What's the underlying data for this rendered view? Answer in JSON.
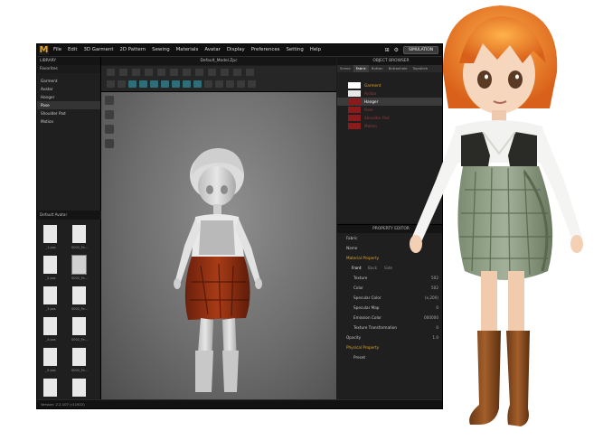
{
  "menu": [
    "File",
    "Edit",
    "3D Garment",
    "2D Pattern",
    "Sewing",
    "Materials",
    "Avatar",
    "Display",
    "Preferences",
    "Setting",
    "Help"
  ],
  "simulation_button": "SIMULATION",
  "library": {
    "title": "LIBRARY",
    "favorites_label": "Favorites",
    "items": [
      {
        "label": "Garment",
        "selected": false
      },
      {
        "label": "Avatar",
        "selected": false
      },
      {
        "label": "Hanger",
        "selected": false
      },
      {
        "label": "Pose",
        "selected": true
      },
      {
        "label": "Shoulder Pad",
        "selected": false
      },
      {
        "label": "Motion",
        "selected": false
      }
    ],
    "subfolder": "Default Avatar",
    "files": [
      "_1.pos",
      "S002_Fe...",
      "_2.pos",
      "S002_Fe...",
      "_3.pos",
      "S002_Fe...",
      "_4.pos",
      "S002_Fe...",
      "_5.pos",
      "S002_Fe...",
      "_6.pos",
      "S002_Fe...",
      "_7.pos",
      "S002_Fe..."
    ]
  },
  "viewport": {
    "title": "Default_Model.Zpc"
  },
  "object_browser": {
    "title": "OBJECT BROWSER",
    "tabs": [
      "Scene",
      "Fabric",
      "Button",
      "Buttonhole",
      "Topstitch"
    ],
    "rows": [
      {
        "label": "Garment",
        "color": "#ffffff",
        "selected": false
      },
      {
        "label": "Avatar",
        "color": "#e8e8e8",
        "selected": false
      },
      {
        "label": "Hanger",
        "color": "#8b1a1a",
        "selected": true
      },
      {
        "label": "Pose",
        "color": "#8b1a1a",
        "selected": false
      },
      {
        "label": "Shoulder Pad",
        "color": "#8b1a1a",
        "selected": false
      },
      {
        "label": "Motion",
        "color": "#8b1a1a",
        "selected": false
      }
    ]
  },
  "property_editor": {
    "title": "PROPERTY EDITOR",
    "fabric_label": "Fabric",
    "name_label": "Name",
    "section_material": "Material Property",
    "face_tabs": [
      "Front",
      "Back",
      "Side"
    ],
    "rows": [
      {
        "k": "Texture",
        "v": "502"
      },
      {
        "k": "Color",
        "v": "502"
      },
      {
        "k": "Specular Color",
        "v": "(x,200)"
      },
      {
        "k": "Specular Map",
        "v": "0"
      },
      {
        "k": "Emission Color",
        "v": "000000"
      },
      {
        "k": "Texture Transformation",
        "v": "0"
      }
    ],
    "opacity_label": "Opacity",
    "opacity_value": "1.0",
    "section_physical": "Physical Property",
    "preset_label": "Preset"
  },
  "status": "Version: 2.2.107 (r11922)",
  "colors": {
    "accent": "#e9a21a",
    "panel": "#1f1f1f",
    "skirt": "#8b2a12"
  }
}
